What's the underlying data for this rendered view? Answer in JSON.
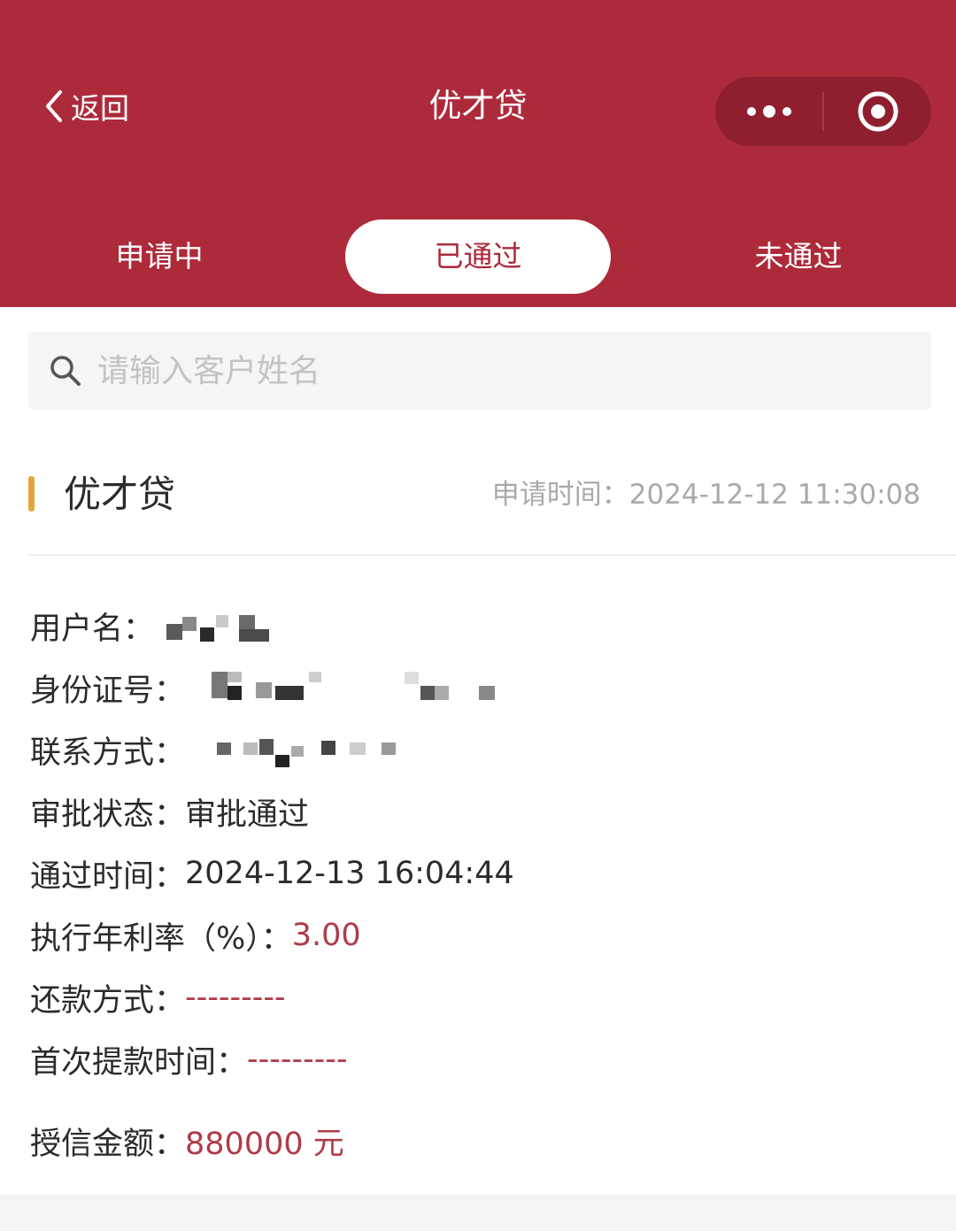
{
  "nav": {
    "back_label": "返回",
    "title": "优才贷"
  },
  "tabs": [
    {
      "label": "申请中",
      "active": false
    },
    {
      "label": "已通过",
      "active": true
    },
    {
      "label": "未通过",
      "active": false
    }
  ],
  "search": {
    "placeholder": "请输入客户姓名",
    "value": ""
  },
  "card": {
    "title": "优才贷",
    "apply_time_label": "申请时间：",
    "apply_time": "2024-12-12 11:30:08",
    "fields": {
      "username_label": "用户名：",
      "id_label": "身份证号：",
      "contact_label": "联系方式：",
      "status_label": "审批状态：",
      "status_value": "审批通过",
      "pass_time_label": "通过时间：",
      "pass_time_value": "2024-12-13 16:04:44",
      "rate_label": "执行年利率（%）：",
      "rate_value": "3.00",
      "repay_label": "还款方式：",
      "repay_value": "---------",
      "first_draw_label": "首次提款时间：",
      "first_draw_value": "---------",
      "credit_label": "授信金额：",
      "credit_value": "880000 元"
    }
  },
  "colors": {
    "brand": "#ad2a3b",
    "accent_bar": "#e4a53a",
    "value_red": "#b03a48"
  },
  "icons": [
    "chevron-left-icon",
    "more-dots-icon",
    "target-circle-icon",
    "search-icon"
  ]
}
